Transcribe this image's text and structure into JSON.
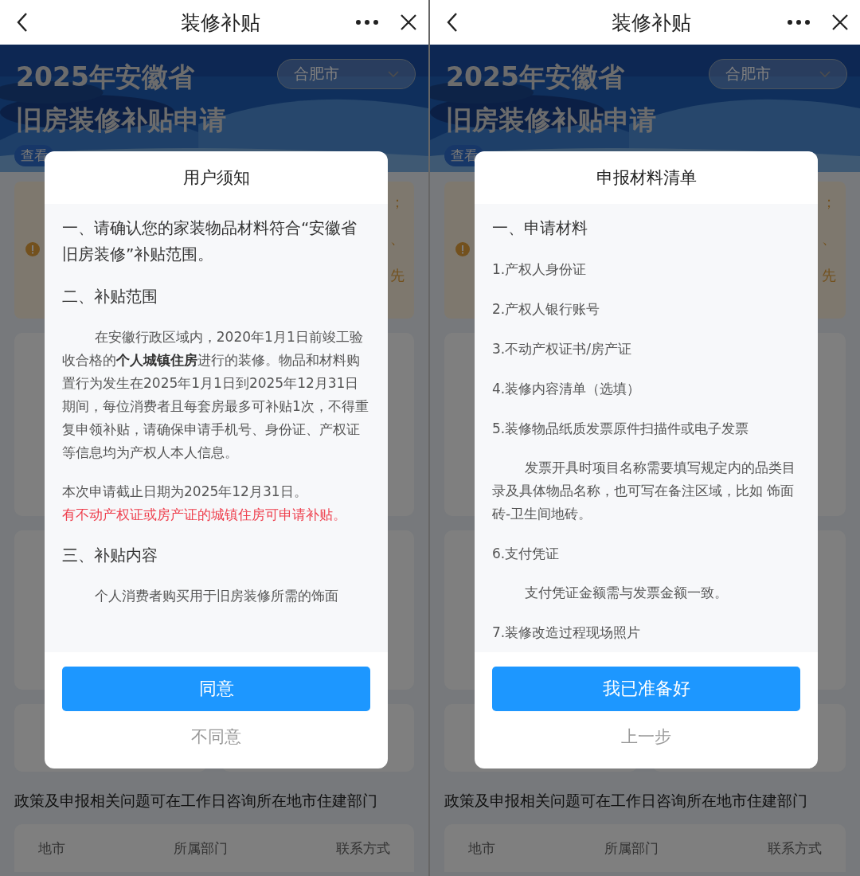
{
  "panels": [
    {
      "header": {
        "title": "装修补贴"
      },
      "background": {
        "banner_title": [
          "2025年安徽省",
          "旧房装修补贴申请"
        ],
        "city_select": "合肥市",
        "link": "查看",
        "warning_fragments": [
          "；",
          "、",
          "先"
        ],
        "footer_note": "政策及申报相关问题可在工作日咨询所在地市住建部门",
        "table_columns": [
          "地市",
          "所属部门",
          "联系方式"
        ]
      },
      "dialog": {
        "title": "用户须知",
        "blocks": [
          {
            "kind": "heading",
            "text": "一、请确认您的家装物品材料符合“安徽省旧房装修”补贴范围。"
          },
          {
            "kind": "heading",
            "text": "二、补贴范围"
          },
          {
            "kind": "paragraph",
            "text": "在安徽行政区域内，2020年1月1日前竣工验收合格的**个人城镇住房**进行的装修。物品和材料购置行为发生在2025年1月1日到2025年12月31日期间，每位消费者且每套房最多可补贴1次，不得重复申领补贴，请确保申请手机号、身份证、产权证等信息均为产权人本人信息。"
          },
          {
            "kind": "note",
            "text": "本次申请截止日期为2025年12月31日。"
          },
          {
            "kind": "alert",
            "text": "有不动产权证或房产证的城镇住房可申请补贴。"
          },
          {
            "kind": "heading",
            "text": "三、补贴内容"
          },
          {
            "kind": "paragraph",
            "text": "个人消费者购买用于旧房装修所需的饰面"
          }
        ],
        "primary_button": "同意",
        "secondary_button": "不同意"
      }
    },
    {
      "header": {
        "title": "装修补贴"
      },
      "background": {
        "banner_title": [
          "2025年安徽省",
          "旧房装修补贴申请"
        ],
        "city_select": "合肥市",
        "link": "查看",
        "warning_fragments": [
          "；",
          "、",
          "先"
        ],
        "footer_note": "政策及申报相关问题可在工作日咨询所在地市住建部门",
        "table_columns": [
          "地市",
          "所属部门",
          "联系方式"
        ]
      },
      "dialog": {
        "title": "申报材料清单",
        "blocks": [
          {
            "kind": "heading",
            "text": "一、申请材料"
          },
          {
            "kind": "item",
            "text": "1.产权人身份证"
          },
          {
            "kind": "item",
            "text": "2.产权人银行账号"
          },
          {
            "kind": "item",
            "text": "3.不动产权证书/房产证"
          },
          {
            "kind": "item",
            "text": "4.装修内容清单（选填）"
          },
          {
            "kind": "item",
            "text": "5.装修物品纸质发票原件扫描件或电子发票"
          },
          {
            "kind": "paragraph",
            "text": "发票开具时项目名称需要填写规定内的品类目录及具体物品名称，也可写在备注区域，比如 饰面砖-卫生间地砖。"
          },
          {
            "kind": "item",
            "text": "6.支付凭证"
          },
          {
            "kind": "paragraph",
            "text": "支付凭证金额需与发票金额一致。"
          },
          {
            "kind": "item",
            "text": "7.装修改造过程现场照片"
          }
        ],
        "primary_button": "我已准备好",
        "secondary_button": "上一步"
      }
    }
  ]
}
